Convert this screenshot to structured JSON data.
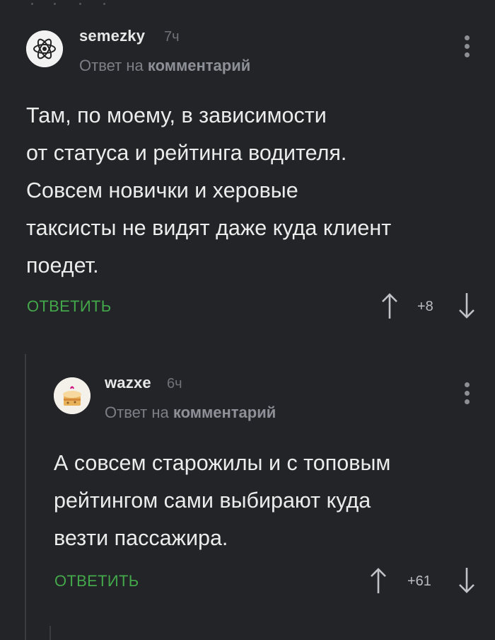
{
  "comments": [
    {
      "username": "semezky",
      "time": "7ч",
      "reply_prefix": "Ответ на",
      "reply_target": "комментарий",
      "text": "Там, по моему, в зависимости\nот статуса и рейтинга водителя.\nСовсем новички и херовые\nтакcисты не видят даже куда клиент\nпоедет.",
      "reply_label": "ОТВЕТИТЬ",
      "rating": "+8",
      "avatar_icon": "atom-icon"
    },
    {
      "username": "wazxe",
      "time": "6ч",
      "reply_prefix": "Ответ на",
      "reply_target": "комментарий",
      "text": "А совсем старожилы и с топовым\nрейтингом сами выбирают куда\nвезти пассажира.",
      "reply_label": "ОТВЕТИТЬ",
      "rating": "+61",
      "avatar_icon": "cake-icon"
    }
  ],
  "colors": {
    "background": "#232428",
    "accent_green": "#43a84a",
    "text": "#ececec",
    "muted": "#7c8086"
  }
}
